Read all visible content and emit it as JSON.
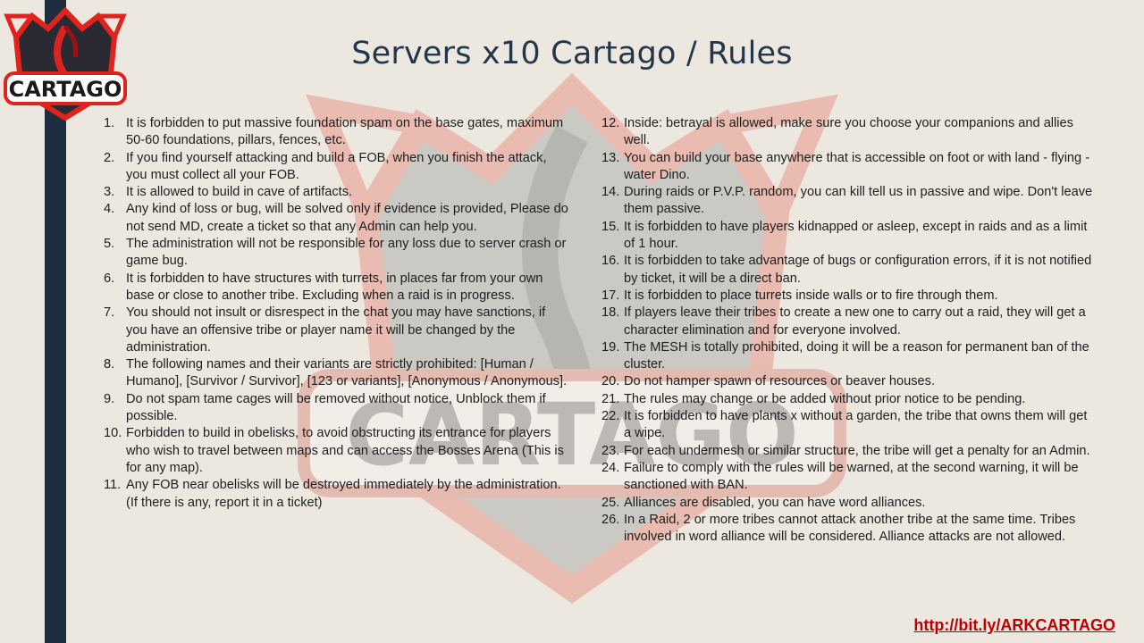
{
  "title": "Servers x10 Cartago / Rules",
  "logo": {
    "text": "CARTAGO"
  },
  "watermark": {
    "text": "CARTAGO"
  },
  "rules_left": [
    {
      "num": "1.",
      "text": "It is forbidden to put massive foundation spam on the base gates, maximum 50-60 foundations, pillars, fences, etc."
    },
    {
      "num": "2.",
      "text": "If you find yourself attacking and build a FOB, when you finish the attack, you must collect all your FOB."
    },
    {
      "num": "3.",
      "text": "It is allowed to build in cave of artifacts."
    },
    {
      "num": "4.",
      "text": "Any kind of loss or bug, will be solved only if evidence is provided, Please do not send MD, create a ticket so that any Admin can help you."
    },
    {
      "num": "5.",
      "text": "The administration will not be responsible for any loss due to server crash or game bug."
    },
    {
      "num": "6.",
      "text": "It is forbidden to have structures with turrets, in places far from your own base or close to another tribe. Excluding when a raid is in progress."
    },
    {
      "num": "7.",
      "text": "You should not insult or disrespect in the chat you may have sanctions, if you have an offensive tribe or player name it will be changed by the administration."
    },
    {
      "num": "8.",
      "text": "The following names and their variants are strictly prohibited: [Human / Humano], [Survivor / Survivor], [123 or variants], [Anonymous / Anonymous]."
    },
    {
      "num": "9.",
      "text": "Do not spam tame cages will be removed without notice, Unblock them if possible."
    },
    {
      "num": "10.",
      "text": "Forbidden to build in obelisks, to avoid obstructing its entrance for players who wish to travel between maps and can access the Bosses Arena (This is for any map)."
    },
    {
      "num": "11.",
      "text": "Any FOB near obelisks will be destroyed immediately by the administration. (If there is any, report it in a ticket)"
    }
  ],
  "rules_right": [
    {
      "num": "12.",
      "text": "Inside: betrayal is allowed, make sure you choose your companions and allies well."
    },
    {
      "num": "13.",
      "text": "You can build your base anywhere that is accessible on foot or with land - flying - water Dino."
    },
    {
      "num": "14.",
      "text": "During raids or P.V.P. random, you can kill tell us in passive and wipe. Don't leave them passive."
    },
    {
      "num": "15.",
      "text": "It is forbidden to have players kidnapped or asleep, except in raids and as a limit of 1 hour."
    },
    {
      "num": "16.",
      "text": "It is forbidden to take advantage of bugs or configuration errors, if it is not notified by ticket, it will be a direct ban."
    },
    {
      "num": "17.",
      "text": "It is forbidden to place turrets inside walls or to fire through them."
    },
    {
      "num": "18.",
      "text": "If players leave their tribes to create a new one to carry out a raid, they will get a character elimination and for everyone involved."
    },
    {
      "num": "19.",
      "text": "The MESH is totally prohibited, doing it will be a reason for permanent ban of the cluster."
    },
    {
      "num": "20.",
      "text": "Do not hamper spawn of resources or beaver houses."
    },
    {
      "num": "21.",
      "text": "The rules may change or be added without prior notice to be pending."
    },
    {
      "num": "22.",
      "text": "It is forbidden to have plants x without a garden, the tribe that owns them will get a wipe."
    },
    {
      "num": "23.",
      "text": "For each undermesh or similar structure, the tribe will get a penalty for an Admin."
    },
    {
      "num": "24.",
      "text": "Failure to comply with the rules will be warned, at the second warning, it will be sanctioned with BAN."
    },
    {
      "num": "25.",
      "text": "Alliances are disabled, you can have word alliances."
    },
    {
      "num": "26.",
      "text": "In a Raid, 2 or more tribes cannot attack another tribe at the same time. Tribes involved in word alliance will be considered. Alliance attacks are not allowed."
    }
  ],
  "link": {
    "text": "http://bit.ly/ARKCARTAGO"
  },
  "colors": {
    "accent_red": "#c00000",
    "navy": "#1d2d3e",
    "title": "#24364a"
  }
}
